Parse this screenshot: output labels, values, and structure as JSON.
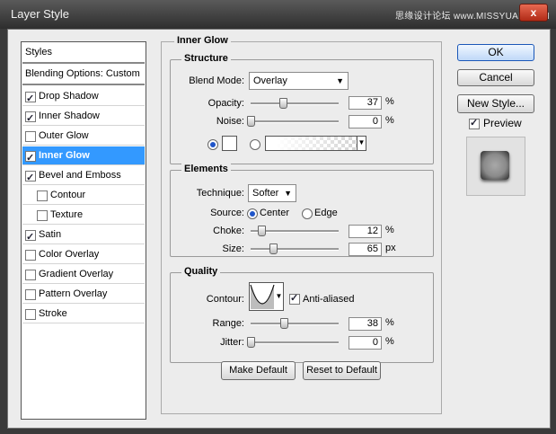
{
  "window": {
    "title": "Layer Style",
    "watermark": "思缘设计论坛 www.MISSYUAN.COM",
    "close_glyph": "x"
  },
  "styles_list": {
    "header": "Styles",
    "blending": "Blending Options: Custom",
    "items": [
      {
        "label": "Drop Shadow",
        "checked": true
      },
      {
        "label": "Inner Shadow",
        "checked": true
      },
      {
        "label": "Outer Glow",
        "checked": false
      },
      {
        "label": "Inner Glow",
        "checked": true,
        "selected": true
      },
      {
        "label": "Bevel and Emboss",
        "checked": true
      },
      {
        "label": "Contour",
        "checked": false,
        "indent": true
      },
      {
        "label": "Texture",
        "checked": false,
        "indent": true
      },
      {
        "label": "Satin",
        "checked": true
      },
      {
        "label": "Color Overlay",
        "checked": false
      },
      {
        "label": "Gradient Overlay",
        "checked": false
      },
      {
        "label": "Pattern Overlay",
        "checked": false
      },
      {
        "label": "Stroke",
        "checked": false
      }
    ]
  },
  "panel": {
    "title": "Inner Glow",
    "structure": {
      "title": "Structure",
      "blend_mode_label": "Blend Mode:",
      "blend_mode_value": "Overlay",
      "opacity_label": "Opacity:",
      "opacity_value": "37",
      "opacity_unit": "%",
      "noise_label": "Noise:",
      "noise_value": "0",
      "noise_unit": "%",
      "opacity_level": 0.37,
      "noise_level": 0.0,
      "color_swatch": "#ffffff"
    },
    "elements": {
      "title": "Elements",
      "technique_label": "Technique:",
      "technique_value": "Softer",
      "source_label": "Source:",
      "source_center": "Center",
      "source_edge": "Edge",
      "choke_label": "Choke:",
      "choke_value": "12",
      "choke_unit": "%",
      "size_label": "Size:",
      "size_value": "65",
      "size_unit": "px",
      "choke_level": 0.12,
      "size_level": 0.26
    },
    "quality": {
      "title": "Quality",
      "contour_label": "Contour:",
      "antialiased_label": "Anti-aliased",
      "range_label": "Range:",
      "range_value": "38",
      "range_unit": "%",
      "jitter_label": "Jitter:",
      "jitter_value": "0",
      "jitter_unit": "%",
      "range_level": 0.38,
      "jitter_level": 0.0
    },
    "make_default": "Make Default",
    "reset_default": "Reset to Default"
  },
  "buttons": {
    "ok": "OK",
    "cancel": "Cancel",
    "new_style": "New Style...",
    "preview_label": "Preview"
  },
  "colors": {
    "accent": "#3399ff",
    "dialog_bg": "#ececec"
  }
}
